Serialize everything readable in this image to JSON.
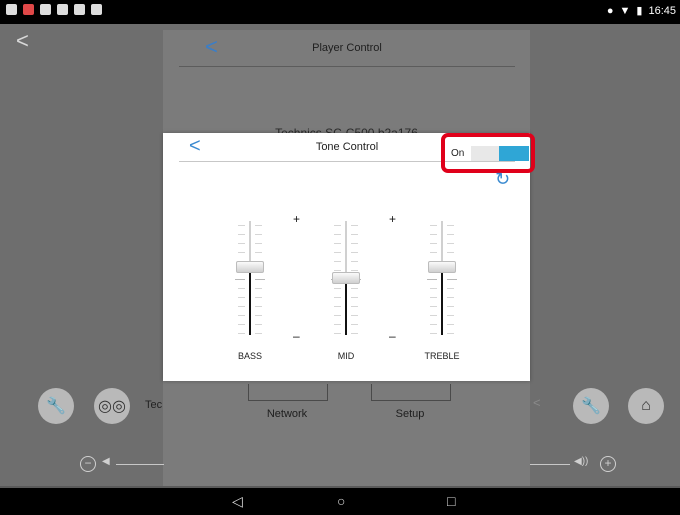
{
  "status_bar": {
    "time": "16:45"
  },
  "player": {
    "title": "Player Control",
    "device_name": "Technics SC-C500 b2a176",
    "device_label_partial": "Tec",
    "tabs": [
      "Network",
      "Setup"
    ]
  },
  "dialog": {
    "title": "Tone Control",
    "toggle": {
      "label": "On",
      "state": true
    },
    "sliders": [
      {
        "name": "BASS",
        "value": 0.6
      },
      {
        "name": "MID",
        "value": 0.5
      },
      {
        "name": "TREBLE",
        "value": 0.6
      }
    ],
    "plus_sign": "+",
    "minus_sign": "–"
  },
  "colors": {
    "accent": "#2fa6d6",
    "highlight_box": "#e0001a"
  },
  "icons": [
    "back-icon",
    "refresh-icon",
    "wrench-icon",
    "home-icon",
    "speaker-icon",
    "share-icon"
  ]
}
